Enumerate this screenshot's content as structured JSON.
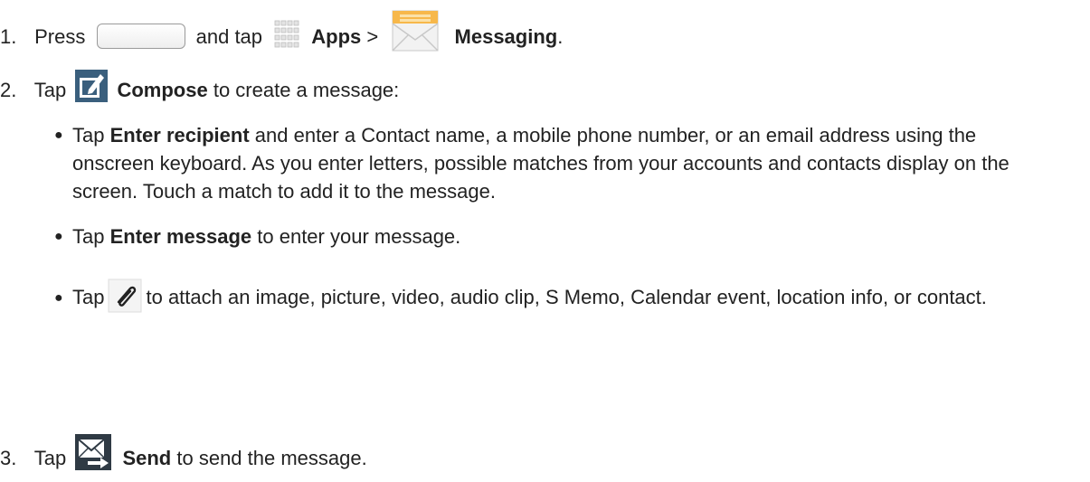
{
  "steps": [
    {
      "number": "1.",
      "t1": "Press",
      "t2": "and tap",
      "bold1": "Apps",
      "t3": ">",
      "bold2": "Messaging",
      "t4": "."
    },
    {
      "number": "2.",
      "t1": "Tap",
      "bold1": "Compose",
      "t2": "to create a message:"
    },
    {
      "number": "3.",
      "t1": "Tap",
      "bold1": "Send",
      "t2": "to send the message."
    }
  ],
  "bullets": [
    {
      "t1": "Tap",
      "bold1": "Enter recipient",
      "t2": "and enter a Contact name, a mobile phone number, or an email address using the onscreen keyboard. As you enter letters, possible matches from your accounts and contacts display on the screen. Touch a match to add it to the message."
    },
    {
      "t1": "Tap",
      "bold1": "Enter message",
      "t2": "to enter your message."
    },
    {
      "t1": "Tap",
      "t2": "to attach an image, picture, video, audio clip, S Memo, Calendar event, location info, or contact."
    }
  ],
  "icons": {
    "home": "home-button-icon",
    "apps": "apps-grid-icon",
    "messaging": "messaging-envelope-icon",
    "compose": "compose-icon",
    "attach": "paperclip-icon",
    "send": "send-icon"
  }
}
